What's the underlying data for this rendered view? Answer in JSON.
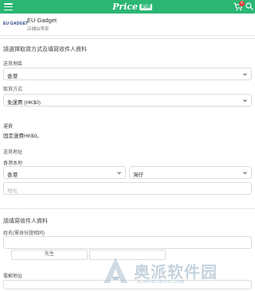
{
  "header": {
    "logo_text": "Price",
    "logo_badge": "網購",
    "cart_count": "0"
  },
  "shop": {
    "logo_text": "EU GADGET",
    "name": "EU Gadget",
    "subtitle": "店舖由賣家"
  },
  "delivery": {
    "section_title": "請選擇取貨方式及填寫收件人資料",
    "region_label": "送貨地區",
    "region_value": "香港",
    "method_label": "取貨方式",
    "method_value": "免運費 (HK$0)",
    "fee_label": "運費",
    "fee_value": "固定運費HK$0。",
    "address_label": "送貨地址",
    "sub_region_label": "香港本地",
    "area_value": "香港",
    "district_value": "灣仔",
    "address_placeholder": "地址"
  },
  "recipient": {
    "section_title": "請填寫收件人資料",
    "name_label": "姓名(需身份證相同)",
    "title_button": "先生",
    "email_label": "電郵地址"
  },
  "watermark": {
    "text": "奥派软件园",
    "sub": "AUPAIRUNION.COM"
  },
  "colors": {
    "brand": "#2bb673",
    "badge": "#e53935"
  },
  "icons": [
    "menu-icon",
    "cart-icon",
    "search-icon",
    "chevron-down-icon"
  ]
}
